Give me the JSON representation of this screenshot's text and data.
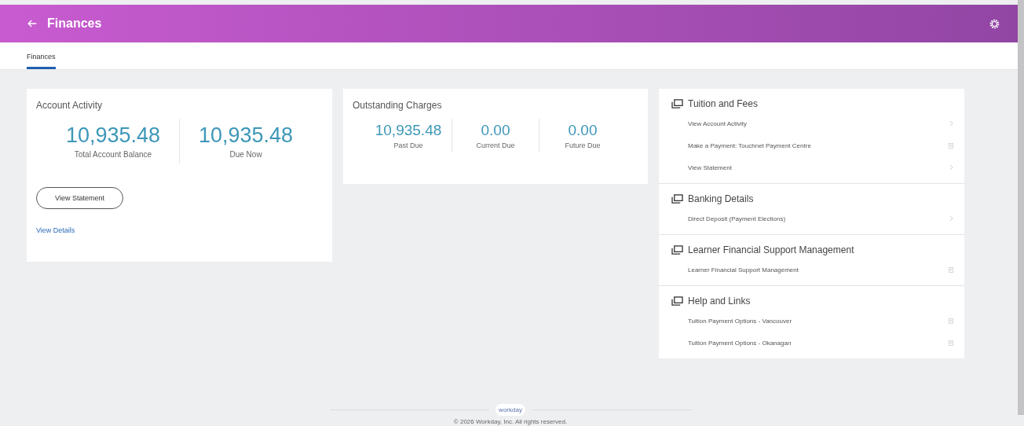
{
  "header": {
    "title": "Finances"
  },
  "tabs": [
    {
      "label": "Finances",
      "selected": true
    }
  ],
  "account_activity": {
    "title": "Account Activity",
    "figures": [
      {
        "value": "10,935.48",
        "label": "Total Account Balance"
      },
      {
        "value": "10,935.48",
        "label": "Due Now"
      }
    ],
    "button": "View Statement",
    "link": "View Details"
  },
  "outstanding_charges": {
    "title": "Outstanding Charges",
    "figures": [
      {
        "value": "10,935.48",
        "label": "Past Due"
      },
      {
        "value": "0.00",
        "label": "Current Due"
      },
      {
        "value": "0.00",
        "label": "Future Due"
      }
    ]
  },
  "sections": [
    {
      "title": "Tuition and Fees",
      "links": [
        {
          "label": "View Account Activity",
          "kind": "chevron"
        },
        {
          "label": "Make a Payment: Touchnet Payment Centre",
          "kind": "external"
        },
        {
          "label": "View Statement",
          "kind": "chevron"
        }
      ]
    },
    {
      "title": "Banking Details",
      "links": [
        {
          "label": "Direct Deposit (Payment Elections)",
          "kind": "chevron"
        }
      ]
    },
    {
      "title": "Learner Financial Support Management",
      "links": [
        {
          "label": "Learner Financial Support Management",
          "kind": "external"
        }
      ]
    },
    {
      "title": "Help and Links",
      "links": [
        {
          "label": "Tuition Payment Options - Vancouver",
          "kind": "external"
        },
        {
          "label": "Tuition Payment Options - Okanagan",
          "kind": "external"
        }
      ]
    }
  ],
  "footer": {
    "logo": "workday",
    "copyright": "© 2026 Workday, Inc. All rights reserved."
  }
}
